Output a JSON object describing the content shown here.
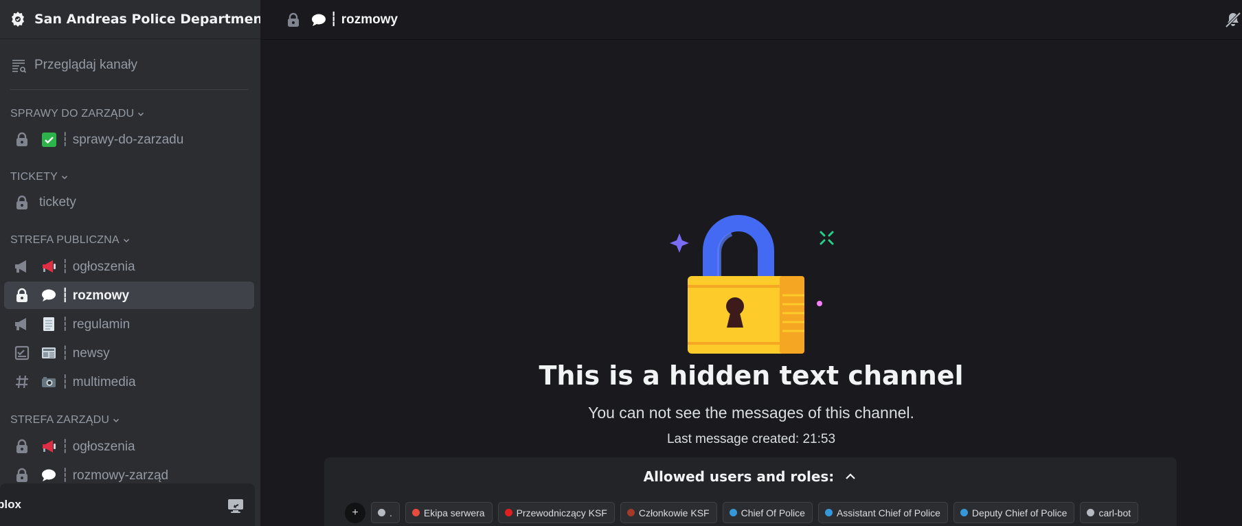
{
  "guild": {
    "name": "San Andreas Police Department"
  },
  "sidebar": {
    "browse_label": "Przeglądaj kanały",
    "categories": [
      {
        "label": "SPRAWY DO ZARZĄDU"
      },
      {
        "label": "TICKETY"
      },
      {
        "label": "STREFA PUBLICZNA"
      },
      {
        "label": "STREFA ZARZĄDU"
      }
    ],
    "channels": [
      {
        "label": "┆ sprawy-do-zarzadu",
        "type_icon": "lock-icon",
        "emoji": "check-mark-emoji"
      },
      {
        "label": "tickety",
        "type_icon": "lock-icon",
        "emoji": ""
      },
      {
        "label": "┆ ogłoszenia",
        "type_icon": "announcement-icon",
        "emoji": "megaphone-emoji"
      },
      {
        "label": "┆ rozmowy",
        "type_icon": "lock-icon",
        "emoji": "speech-bubble-emoji",
        "active": true
      },
      {
        "label": "┆ regulamin",
        "type_icon": "announcement-icon",
        "emoji": "document-emoji"
      },
      {
        "label": "┆ newsy",
        "type_icon": "checklist-icon",
        "emoji": "newspaper-emoji"
      },
      {
        "label": "┆ multimedia",
        "type_icon": "hash-icon",
        "emoji": "camera-emoji"
      },
      {
        "label": "┆ ogłoszenia",
        "type_icon": "lock-icon",
        "emoji": "megaphone-emoji"
      },
      {
        "label": "┆ rozmowy-zarząd",
        "type_icon": "lock-icon",
        "emoji": "speech-bubble-emoji"
      }
    ]
  },
  "userbar": {
    "name": "plox"
  },
  "topbar": {
    "channel_name": "┆ rozmowy"
  },
  "hidden": {
    "title": "This is a hidden text channel",
    "subtitle": "You can not see the messages of this channel.",
    "last_message": "Last message created: 21:53"
  },
  "allowed": {
    "title": "Allowed users and roles:",
    "add_label": "+",
    "roles": [
      {
        "label": ".",
        "color": "#b5bac1"
      },
      {
        "label": "Ekipa serwera",
        "color": "#e74c3c"
      },
      {
        "label": "Przewodniczący KSF",
        "color": "#e02020"
      },
      {
        "label": "Członkowie KSF",
        "color": "#a33a2a"
      },
      {
        "label": "Chief Of Police",
        "color": "#3498db"
      },
      {
        "label": "Assistant Chief of Police",
        "color": "#3498db"
      },
      {
        "label": "Deputy Chief of Police",
        "color": "#3498db"
      },
      {
        "label": "carl-bot",
        "color": "#b5bac1"
      }
    ]
  }
}
